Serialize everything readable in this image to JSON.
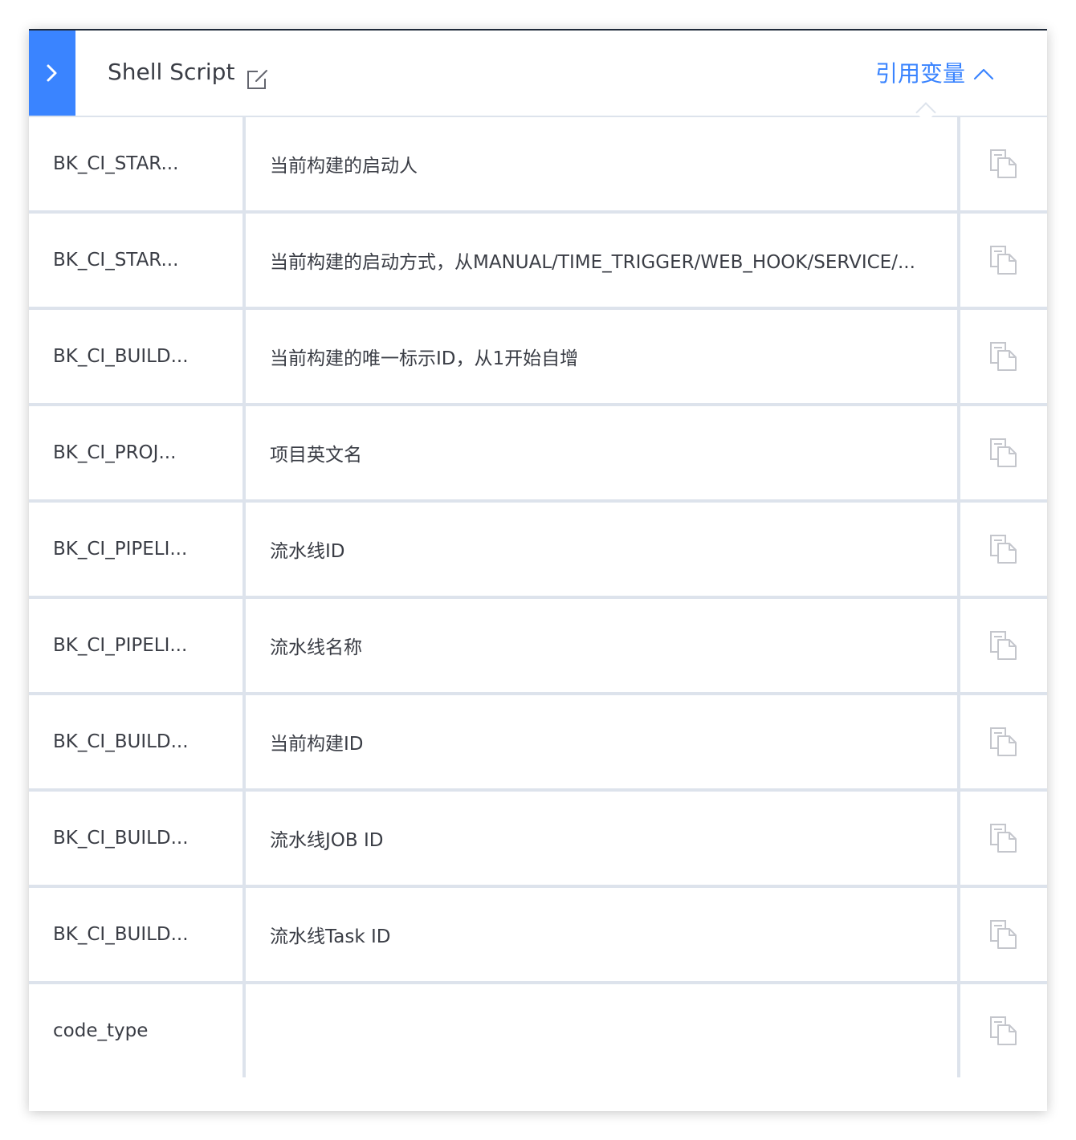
{
  "header": {
    "title": "Shell Script",
    "reference_label": "引用变量",
    "icons": {
      "toggle": "chevron-right-icon",
      "edit": "edit-icon",
      "collapse": "chevron-up-icon",
      "copy": "copy-icon"
    },
    "colors": {
      "accent": "#3a84ff",
      "border": "#dde3ec",
      "text": "#3a3d45",
      "icon": "#c4c6cc"
    }
  },
  "variables": [
    {
      "name": "BK_CI_STAR...",
      "desc": "当前构建的启动人"
    },
    {
      "name": "BK_CI_STAR...",
      "desc": "当前构建的启动方式，从MANUAL/TIME_TRIGGER/WEB_HOOK/SERVICE/..."
    },
    {
      "name": "BK_CI_BUILD...",
      "desc": "当前构建的唯一标示ID，从1开始自增"
    },
    {
      "name": "BK_CI_PROJ...",
      "desc": "项目英文名"
    },
    {
      "name": "BK_CI_PIPELI...",
      "desc": "流水线ID"
    },
    {
      "name": "BK_CI_PIPELI...",
      "desc": "流水线名称"
    },
    {
      "name": "BK_CI_BUILD...",
      "desc": "当前构建ID"
    },
    {
      "name": "BK_CI_BUILD...",
      "desc": "流水线JOB ID"
    },
    {
      "name": "BK_CI_BUILD...",
      "desc": "流水线Task ID"
    },
    {
      "name": "code_type",
      "desc": ""
    }
  ]
}
